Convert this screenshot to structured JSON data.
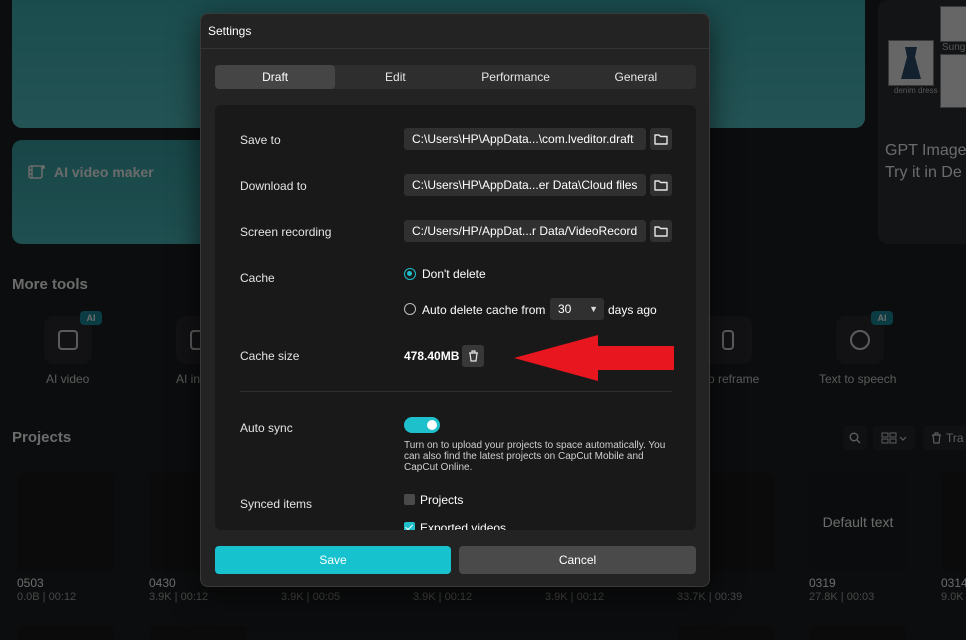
{
  "background": {
    "hero_card_label": "AI video maker",
    "gpt_card": {
      "line1": "GPT Image",
      "line2": "Try it in De"
    },
    "right_panel_texts": [
      "Sunglas",
      "denim dress"
    ],
    "more_tools_title": "More tools",
    "tools": [
      {
        "label": "AI video",
        "badge": "AI"
      },
      {
        "label": "AI in",
        "badge": ""
      },
      {
        "label": "o reframe",
        "badge": ""
      },
      {
        "label": "Text to speech",
        "badge": "AI"
      }
    ],
    "projects_title": "Projects",
    "trash_label": "Tra",
    "projects": [
      {
        "name": "0503",
        "meta": "0.0B | 00:12"
      },
      {
        "name": "0430",
        "meta": "3.9K | 00:12"
      },
      {
        "name": "",
        "meta": "3.9K | 00:05"
      },
      {
        "name": "",
        "meta": "3.9K | 00:12"
      },
      {
        "name": "",
        "meta": "3.9K | 00:12"
      },
      {
        "name": "",
        "meta": "33.7K | 00:39"
      },
      {
        "name": "0319",
        "meta": "27.8K | 00:03"
      },
      {
        "name": "0314",
        "meta": "9.0K"
      }
    ],
    "default_text": "Default text"
  },
  "modal": {
    "title": "Settings",
    "tabs": [
      {
        "label": "Draft",
        "active": true
      },
      {
        "label": "Edit",
        "active": false
      },
      {
        "label": "Performance",
        "active": false
      },
      {
        "label": "General",
        "active": false
      }
    ],
    "save_to": {
      "label": "Save to",
      "value": "C:\\Users\\HP\\AppData...\\com.lveditor.draft"
    },
    "download_to": {
      "label": "Download to",
      "value": "C:\\Users\\HP\\AppData...er Data\\Cloud files"
    },
    "screen_recording": {
      "label": "Screen recording",
      "value": "C:/Users/HP/AppDat...r Data/VideoRecord"
    },
    "cache": {
      "label": "Cache",
      "option_dont_delete": "Don't delete",
      "option_auto_delete_prefix": "Auto delete cache from",
      "days_value": "30",
      "option_auto_delete_suffix": "days ago",
      "selected": "dont_delete"
    },
    "cache_size": {
      "label": "Cache size",
      "value": "478.40MB"
    },
    "auto_sync": {
      "label": "Auto sync",
      "enabled": true,
      "description": "Turn on to upload your projects to space automatically. You can also find the latest projects on CapCut Mobile and CapCut Online."
    },
    "synced_items": {
      "label": "Synced items",
      "items": [
        {
          "label": "Projects",
          "checked": false
        },
        {
          "label": "Exported videos",
          "checked": true
        }
      ]
    },
    "save_label": "Save",
    "cancel_label": "Cancel"
  },
  "colors": {
    "accent": "#17c2cf",
    "annotation_arrow": "#e8161f"
  }
}
